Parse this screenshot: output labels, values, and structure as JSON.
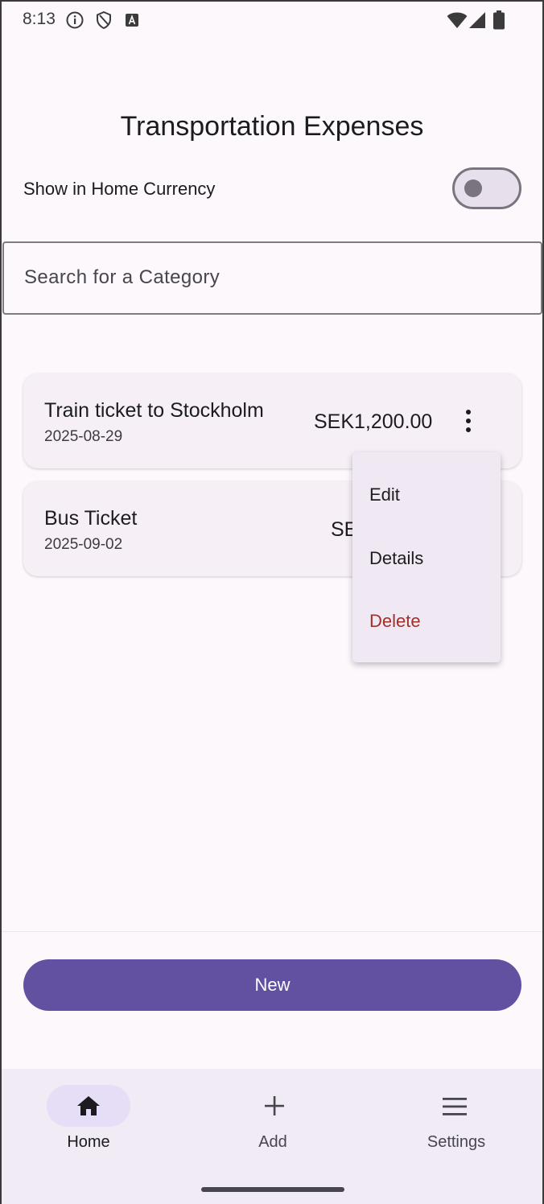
{
  "status_bar": {
    "time": "8:13",
    "icons_left": [
      "info-icon",
      "shield-icon",
      "font-icon"
    ],
    "icons_right": [
      "wifi-icon",
      "signal-icon",
      "battery-icon"
    ]
  },
  "header": {
    "title": "Transportation Expenses"
  },
  "home_currency_toggle": {
    "label": "Show in Home Currency",
    "enabled": false
  },
  "search": {
    "placeholder": "Search for a Category"
  },
  "expenses": [
    {
      "title": "Train ticket to Stockholm",
      "date": "2025-08-29",
      "amount": "SEK1,200.00"
    },
    {
      "title": "Bus Ticket",
      "date": "2025-09-02",
      "amount": "SE"
    }
  ],
  "context_menu": {
    "items": [
      "Edit",
      "Details",
      "Delete"
    ]
  },
  "actions": {
    "new_label": "New"
  },
  "bottom_nav": {
    "items": [
      {
        "label": "Home",
        "icon": "home-icon",
        "active": true
      },
      {
        "label": "Add",
        "icon": "plus-icon",
        "active": false
      },
      {
        "label": "Settings",
        "icon": "menu-icon",
        "active": false
      }
    ]
  },
  "colors": {
    "primary": "#6250a1",
    "background": "#fcf8fc",
    "card": "#f6f0f6",
    "delete": "#a1302a",
    "nav_background": "#f0ebf4"
  }
}
